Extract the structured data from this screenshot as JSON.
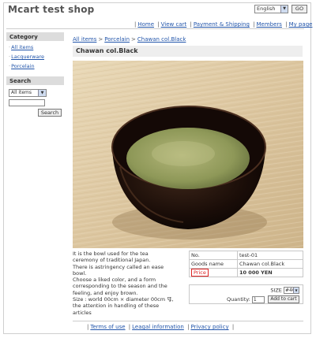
{
  "header": {
    "shop_title": "Mcart test shop",
    "language": "English",
    "go_label": "GO"
  },
  "topnav": [
    "Home",
    "View cart",
    "Payment & Shipping",
    "Members",
    "My page"
  ],
  "sidebar": {
    "category_title": "Category",
    "categories": [
      "All items",
      "Lacquerware",
      "Porcelain"
    ],
    "search_title": "Search",
    "search_scope": "All items",
    "search_button": "Search"
  },
  "breadcrumb": [
    "All items",
    "Porcelain",
    "Chawan col.Black"
  ],
  "product": {
    "title": "Chawan col.Black",
    "description": [
      "It is the bowl used for the tea",
      "ceremony of traditional Japan.",
      "There is astringency called an ease",
      "bowl.",
      "Choose a liked color, and a form",
      "corresponding to the season and the",
      "feeling, and enjoy brown.",
      "Size : world 00cm × diameter 00cm 㸦,",
      "the attention in handling of these",
      "articles"
    ],
    "spec": {
      "no_label": "No.",
      "no_value": "test-01",
      "goods_label": "Goods name",
      "goods_value": "Chawan col.Black",
      "price_label": "Price",
      "price_value": "10 000 YEN"
    },
    "size_label": "SIZE",
    "size_value": "#46",
    "quantity_label": "Quantity:",
    "quantity_value": "1",
    "add_to_cart": "Add to cart"
  },
  "footer": [
    "Terms of use",
    "Leagal information",
    "Privacy policy"
  ],
  "colors": {
    "link": "#2255aa",
    "price_highlight": "#dd2222",
    "sidebar_header": "#dcdcdc"
  }
}
